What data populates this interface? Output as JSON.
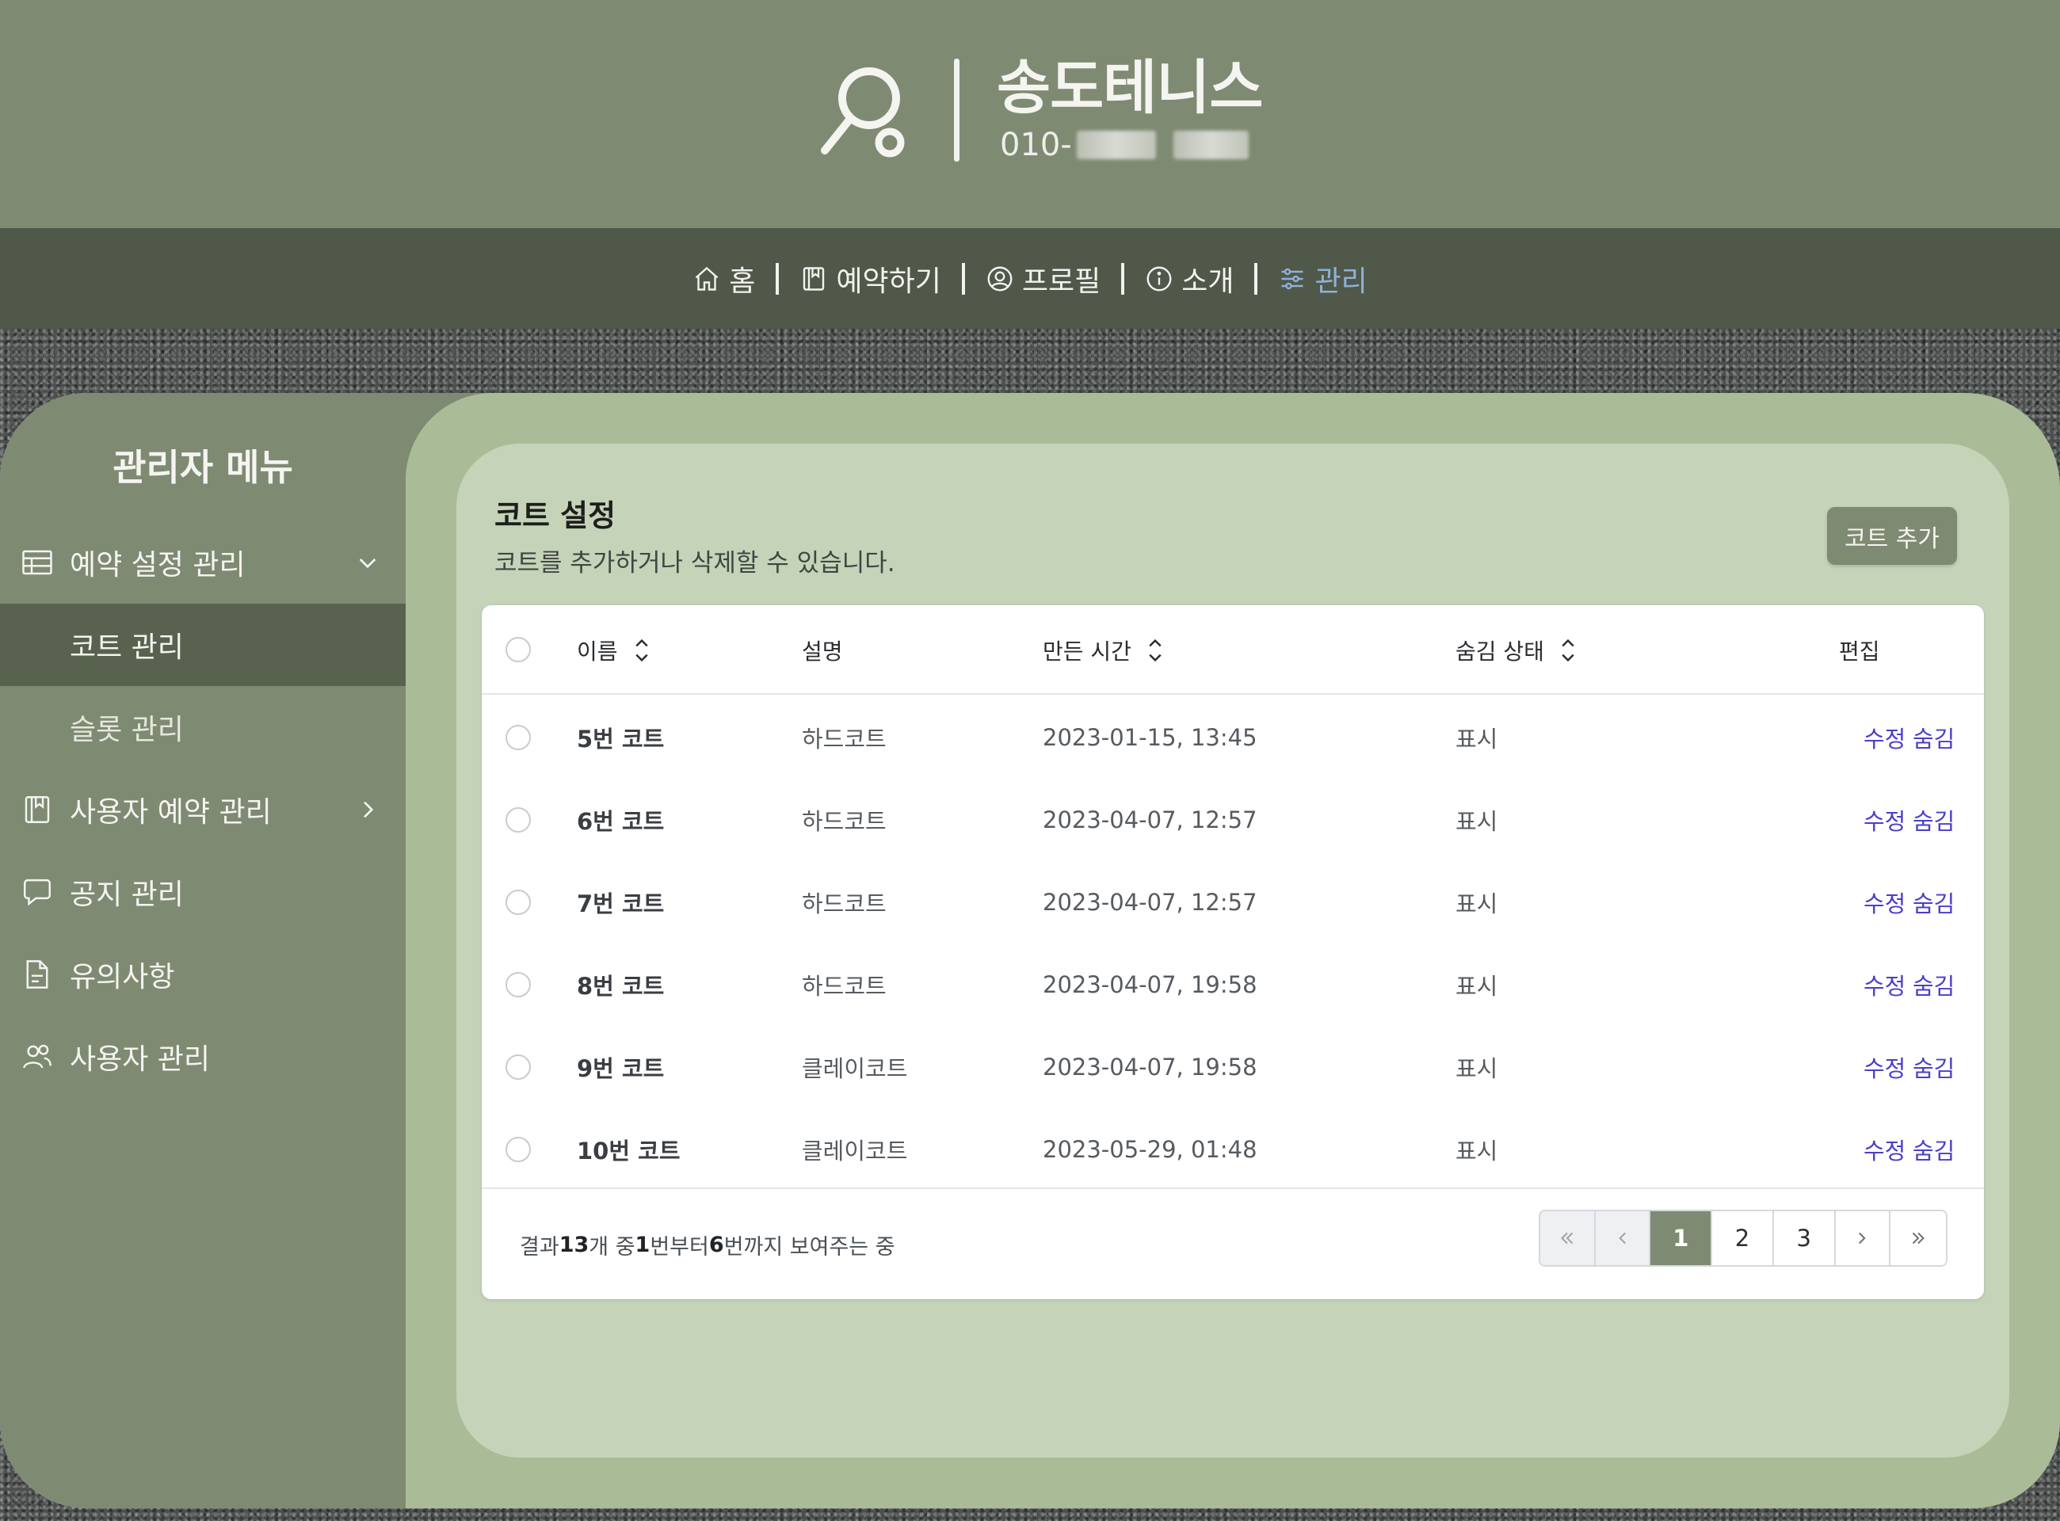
{
  "header": {
    "brand_name": "송도테니스",
    "phone_prefix": "010-"
  },
  "nav": {
    "items": [
      {
        "label": "홈",
        "icon": "home-icon"
      },
      {
        "label": "예약하기",
        "icon": "book-icon"
      },
      {
        "label": "프로필",
        "icon": "user-circle-icon"
      },
      {
        "label": "소개",
        "icon": "info-icon"
      },
      {
        "label": "관리",
        "icon": "sliders-icon",
        "active": true
      }
    ],
    "active_color": "#8fb1d9"
  },
  "sidebar": {
    "title": "관리자 메뉴",
    "items": [
      {
        "label": "예약 설정 관리",
        "icon": "table-icon",
        "chevron": "chevron-down-icon"
      },
      {
        "label": "코트 관리",
        "selected": true
      },
      {
        "label": "슬롯 관리"
      },
      {
        "label": "사용자 예약 관리",
        "icon": "book-icon",
        "chevron": "chevron-right-icon"
      },
      {
        "label": "공지 관리",
        "icon": "chat-bubble-icon"
      },
      {
        "label": "유의사항",
        "icon": "document-icon"
      },
      {
        "label": "사용자 관리",
        "icon": "users-icon"
      }
    ]
  },
  "main": {
    "title": "코트 설정",
    "subtitle": "코트를 추가하거나 삭제할 수 있습니다.",
    "add_button": "코트 추가",
    "columns": [
      "이름",
      "설명",
      "만든 시간",
      "숨김 상태",
      "편집"
    ],
    "rows": [
      {
        "name": "5번 코트",
        "desc": "하드코트",
        "created": "2023-01-15, 13:45",
        "hidden": "표시",
        "edit": "수정",
        "hide": "숨김"
      },
      {
        "name": "6번 코트",
        "desc": "하드코트",
        "created": "2023-04-07, 12:57",
        "hidden": "표시",
        "edit": "수정",
        "hide": "숨김"
      },
      {
        "name": "7번 코트",
        "desc": "하드코트",
        "created": "2023-04-07, 12:57",
        "hidden": "표시",
        "edit": "수정",
        "hide": "숨김"
      },
      {
        "name": "8번 코트",
        "desc": "하드코트",
        "created": "2023-04-07, 19:58",
        "hidden": "표시",
        "edit": "수정",
        "hide": "숨김"
      },
      {
        "name": "9번 코트",
        "desc": "클레이코트",
        "created": "2023-04-07, 19:58",
        "hidden": "표시",
        "edit": "수정",
        "hide": "숨김"
      },
      {
        "name": "10번 코트",
        "desc": "클레이코트",
        "created": "2023-05-29, 01:48",
        "hidden": "표시",
        "edit": "수정",
        "hide": "숨김"
      }
    ],
    "footer": {
      "t1": "결과 ",
      "total": "13",
      "t2": "개 중 ",
      "from": "1",
      "t3": "번부터 ",
      "to": "6",
      "t4": "번까지 보여주는 중"
    },
    "pages": [
      "1",
      "2",
      "3"
    ],
    "current_page": "1"
  },
  "colors": {
    "header": "#7f8a72",
    "nav": "#4f5849",
    "panel": "#aabb98",
    "inner": "#c5d3b9",
    "link": "#4b3fc9"
  }
}
